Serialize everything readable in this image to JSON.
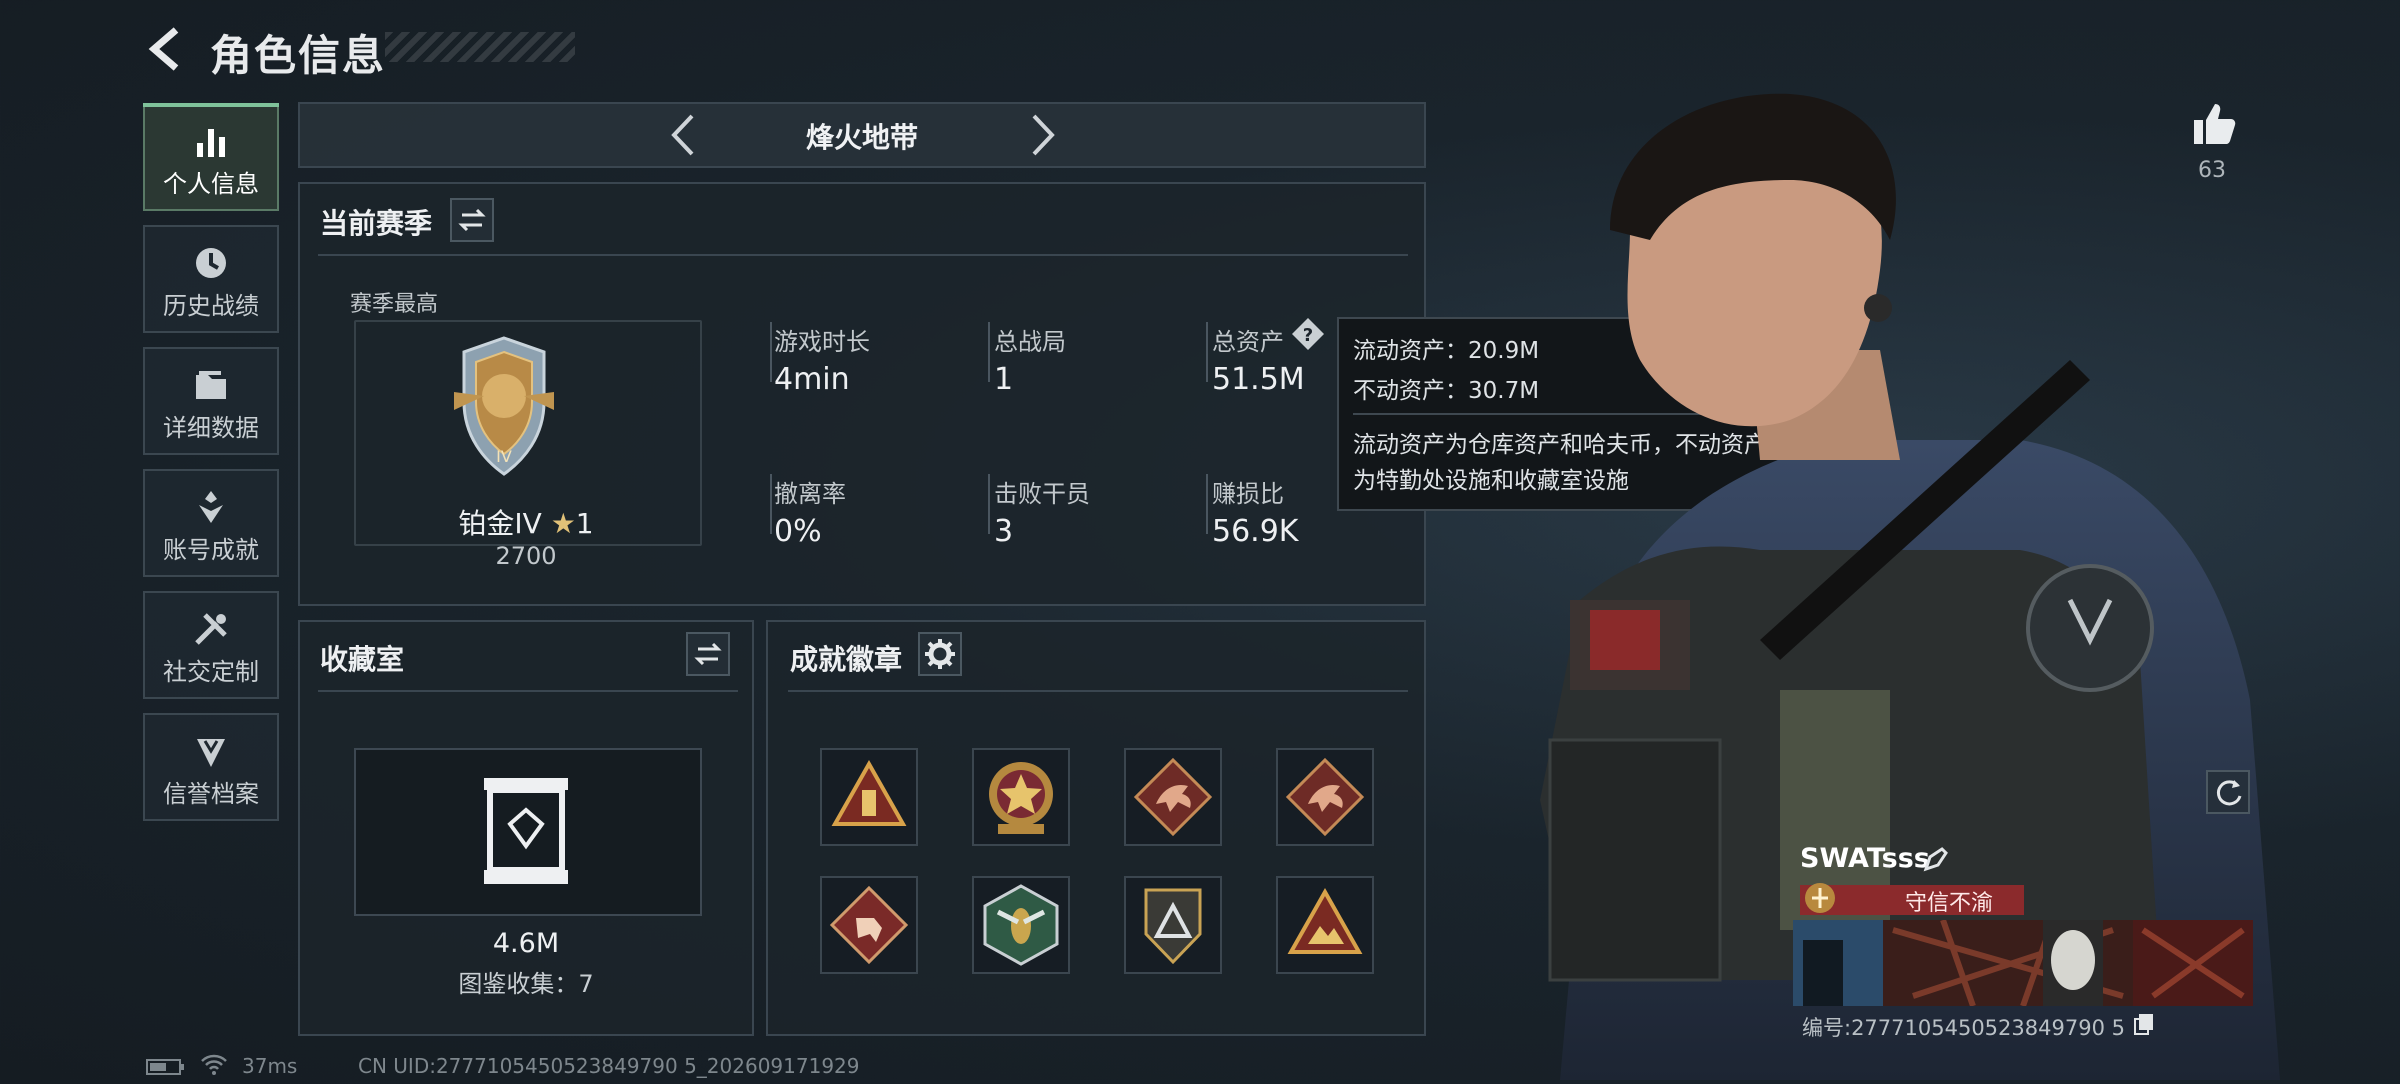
{
  "header": {
    "title": "角色信息"
  },
  "nav": {
    "items": [
      {
        "label": "个人信息",
        "icon": "bar-chart-icon",
        "active": true
      },
      {
        "label": "历史战绩",
        "icon": "clock-icon"
      },
      {
        "label": "详细数据",
        "icon": "folder-icon"
      },
      {
        "label": "账号成就",
        "icon": "badge-icon"
      },
      {
        "label": "社交定制",
        "icon": "tools-icon"
      },
      {
        "label": "信誉档案",
        "icon": "shield-icon"
      }
    ]
  },
  "mode_selector": {
    "label": "烽火地带"
  },
  "season": {
    "title": "当前赛季",
    "best_label": "赛季最高",
    "rank_name": "铂金IV",
    "rank_stars": "1",
    "rank_points": "2700",
    "stats": [
      {
        "label": "游戏时长",
        "value": "4min"
      },
      {
        "label": "总战局",
        "value": "1"
      },
      {
        "label": "总资产",
        "value": "51.5M"
      },
      {
        "label": "撤离率",
        "value": "0%"
      },
      {
        "label": "击败干员",
        "value": "3"
      },
      {
        "label": "赚损比",
        "value": "56.9K"
      }
    ]
  },
  "tooltip": {
    "liquid": "流动资产：20.9M",
    "fixed": "不动资产：30.7M",
    "note_line1": "流动资产为仓库资产和哈夫币，不动资产",
    "note_line2": "为特勤处设施和收藏室设施"
  },
  "collection": {
    "title": "收藏室",
    "value": "4.6M",
    "catalog": "图鉴收集：7"
  },
  "achievements": {
    "title": "成就徽章",
    "badges": [
      "triangle-badge-icon",
      "star-medal-icon",
      "dragon-badge-icon",
      "dragon-badge-icon",
      "runner-badge-icon",
      "wasp-badge-icon",
      "shield-triangle-badge-icon",
      "triangle-mountain-badge-icon"
    ]
  },
  "likes": {
    "count": "63"
  },
  "player": {
    "name": "SWATsss",
    "title": "守信不渝",
    "uid": "编号:2777105450523849790 5"
  },
  "footer": {
    "ping": "37ms",
    "uid": "CN UID:2777105450523849790 5_202609171929"
  },
  "colors": {
    "accent": "#7fc29a",
    "title_red": "#8b2a2c"
  }
}
